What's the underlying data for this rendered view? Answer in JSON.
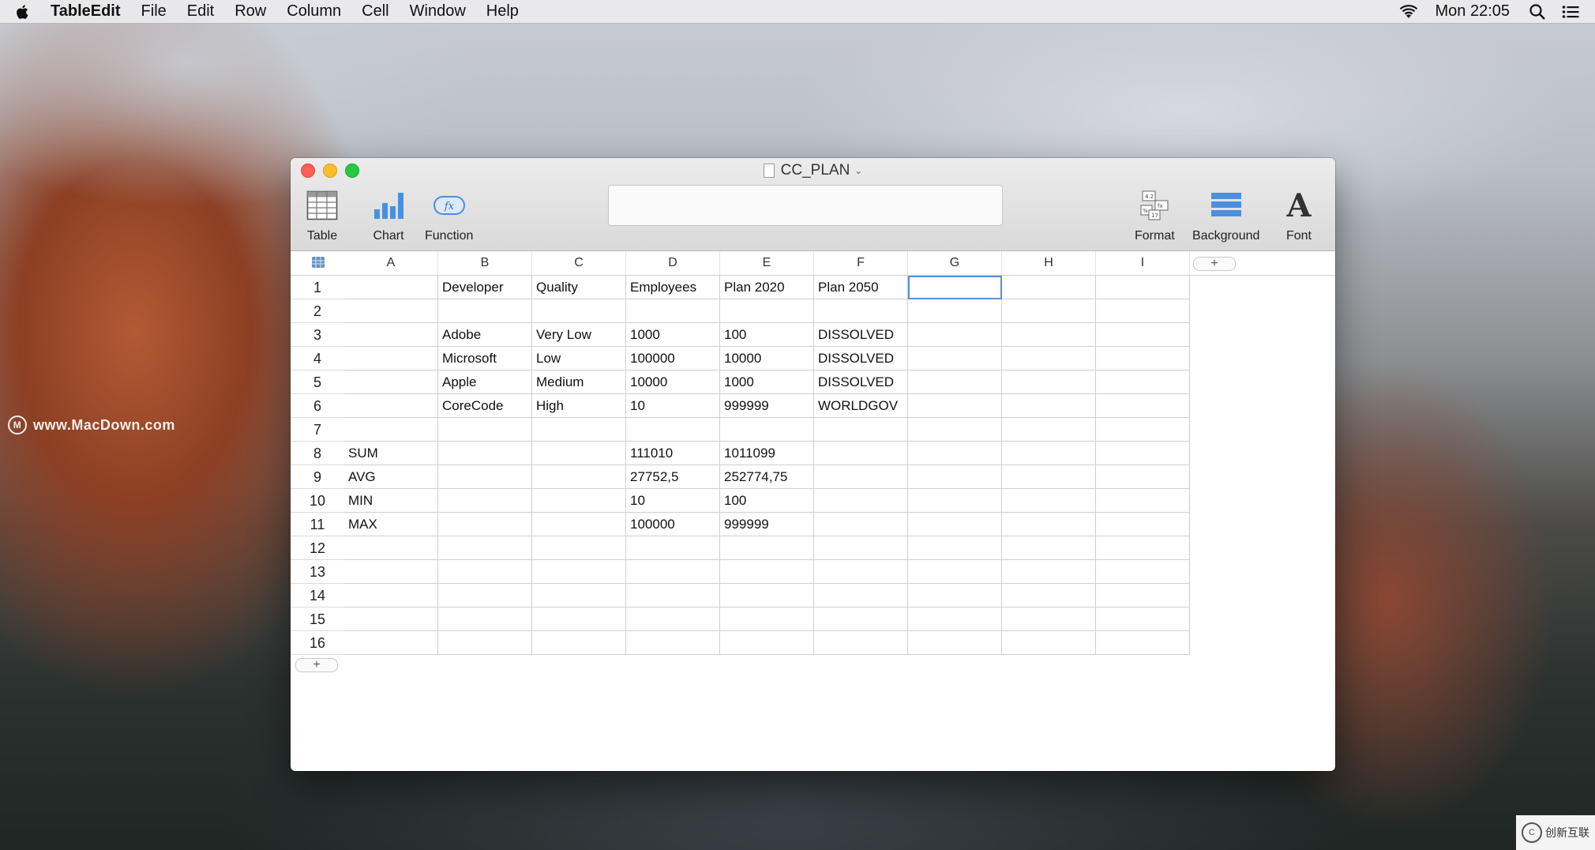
{
  "menubar": {
    "app_name": "TableEdit",
    "items": [
      "File",
      "Edit",
      "Row",
      "Column",
      "Cell",
      "Window",
      "Help"
    ],
    "clock": "Mon 22:05"
  },
  "watermark": {
    "text": "www.MacDown.com",
    "corner_text": "创新互联"
  },
  "window": {
    "title": "CC_PLAN",
    "toolbar": {
      "table": "Table",
      "chart": "Chart",
      "function": "Function",
      "format": "Format",
      "background": "Background",
      "font": "Font"
    },
    "formula_value": "",
    "columns": [
      "A",
      "B",
      "C",
      "D",
      "E",
      "F",
      "G",
      "H",
      "I"
    ],
    "add_column": "+",
    "add_row": "+",
    "selected_cell": "G1",
    "rows": [
      {
        "num": "1",
        "cells": [
          "",
          "Developer",
          "Quality",
          "Employees",
          "Plan 2020",
          "Plan 2050",
          "",
          "",
          ""
        ]
      },
      {
        "num": "2",
        "cells": [
          "",
          "",
          "",
          "",
          "",
          "",
          "",
          "",
          ""
        ]
      },
      {
        "num": "3",
        "cells": [
          "",
          "Adobe",
          "Very Low",
          "1000",
          "100",
          "DISSOLVED",
          "",
          "",
          ""
        ]
      },
      {
        "num": "4",
        "cells": [
          "",
          "Microsoft",
          "Low",
          "100000",
          "10000",
          "DISSOLVED",
          "",
          "",
          ""
        ]
      },
      {
        "num": "5",
        "cells": [
          "",
          "Apple",
          "Medium",
          "10000",
          "1000",
          "DISSOLVED",
          "",
          "",
          ""
        ]
      },
      {
        "num": "6",
        "cells": [
          "",
          "CoreCode",
          "High",
          "10",
          "999999",
          "WORLDGOV",
          "",
          "",
          ""
        ]
      },
      {
        "num": "7",
        "cells": [
          "",
          "",
          "",
          "",
          "",
          "",
          "",
          "",
          ""
        ]
      },
      {
        "num": "8",
        "cells": [
          "SUM",
          "",
          "",
          "111010",
          "1011099",
          "",
          "",
          "",
          ""
        ]
      },
      {
        "num": "9",
        "cells": [
          "AVG",
          "",
          "",
          "27752,5",
          "252774,75",
          "",
          "",
          "",
          ""
        ]
      },
      {
        "num": "10",
        "cells": [
          "MIN",
          "",
          "",
          "10",
          "100",
          "",
          "",
          "",
          ""
        ]
      },
      {
        "num": "11",
        "cells": [
          "MAX",
          "",
          "",
          "100000",
          "999999",
          "",
          "",
          "",
          ""
        ]
      },
      {
        "num": "12",
        "cells": [
          "",
          "",
          "",
          "",
          "",
          "",
          "",
          "",
          ""
        ]
      },
      {
        "num": "13",
        "cells": [
          "",
          "",
          "",
          "",
          "",
          "",
          "",
          "",
          ""
        ]
      },
      {
        "num": "14",
        "cells": [
          "",
          "",
          "",
          "",
          "",
          "",
          "",
          "",
          ""
        ]
      },
      {
        "num": "15",
        "cells": [
          "",
          "",
          "",
          "",
          "",
          "",
          "",
          "",
          ""
        ]
      },
      {
        "num": "16",
        "cells": [
          "",
          "",
          "",
          "",
          "",
          "",
          "",
          "",
          ""
        ]
      }
    ]
  }
}
